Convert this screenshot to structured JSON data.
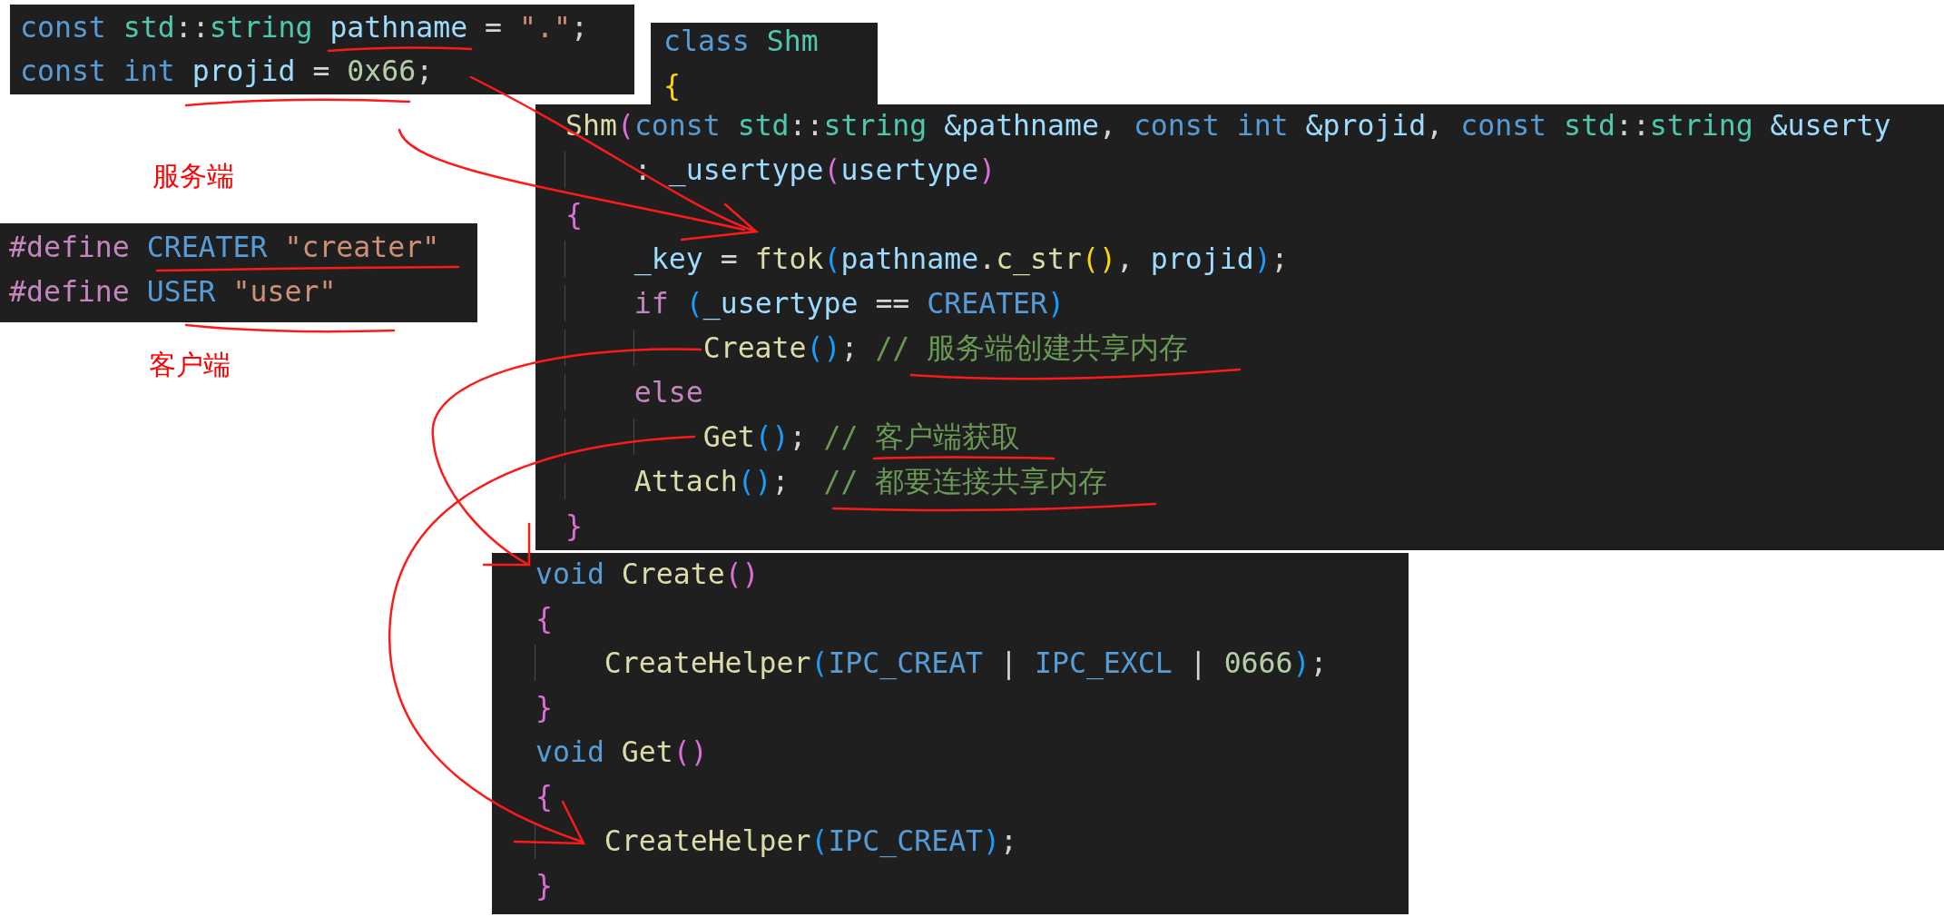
{
  "panels": [
    {
      "lines": [
        [
          {
            "text": "const",
            "color": "#569cd6"
          },
          {
            "text": " std",
            "color": "#4ec9b0"
          },
          {
            "text": "::",
            "color": "#d4d4d4"
          },
          {
            "text": "string",
            "color": "#4ec9b0"
          },
          {
            "text": " pathname",
            "color": "#9cdcfe"
          },
          {
            "text": " = ",
            "color": "#d4d4d4"
          },
          {
            "text": "\".\"",
            "color": "#ce9178"
          },
          {
            "text": ";",
            "color": "#d4d4d4"
          }
        ],
        [
          {
            "text": "const",
            "color": "#569cd6"
          },
          {
            "text": " int",
            "color": "#569cd6"
          },
          {
            "text": " projid",
            "color": "#9cdcfe"
          },
          {
            "text": " = ",
            "color": "#d4d4d4"
          },
          {
            "text": "0x66",
            "color": "#b5cea8"
          },
          {
            "text": ";",
            "color": "#d4d4d4"
          }
        ]
      ]
    },
    {
      "lines": [
        [
          {
            "text": "class",
            "color": "#569cd6"
          },
          {
            "text": " Shm",
            "color": "#4ec9b0"
          }
        ],
        [
          {
            "text": "{",
            "color": "#ffd700"
          }
        ]
      ]
    },
    {
      "lines": [
        [
          {
            "text": "Shm",
            "color": "#dcdcaa"
          },
          {
            "text": "(",
            "color": "#da70d6"
          },
          {
            "text": "const",
            "color": "#569cd6"
          },
          {
            "text": " std",
            "color": "#4ec9b0"
          },
          {
            "text": "::",
            "color": "#d4d4d4"
          },
          {
            "text": "string",
            "color": "#4ec9b0"
          },
          {
            "text": " &pathname",
            "color": "#9cdcfe"
          },
          {
            "text": ", ",
            "color": "#d4d4d4"
          },
          {
            "text": "const",
            "color": "#569cd6"
          },
          {
            "text": " int",
            "color": "#569cd6"
          },
          {
            "text": " &projid",
            "color": "#9cdcfe"
          },
          {
            "text": ", ",
            "color": "#d4d4d4"
          },
          {
            "text": "const",
            "color": "#569cd6"
          },
          {
            "text": " std",
            "color": "#4ec9b0"
          },
          {
            "text": "::",
            "color": "#d4d4d4"
          },
          {
            "text": "string",
            "color": "#4ec9b0"
          },
          {
            "text": " &userty",
            "color": "#9cdcfe"
          }
        ],
        [
          {
            "text": "    : ",
            "color": "#d4d4d4"
          },
          {
            "text": "_usertype",
            "color": "#9cdcfe"
          },
          {
            "text": "(",
            "color": "#da70d6"
          },
          {
            "text": "usertype",
            "color": "#9cdcfe"
          },
          {
            "text": ")",
            "color": "#da70d6"
          }
        ],
        [
          {
            "text": "{",
            "color": "#da70d6"
          }
        ],
        [
          {
            "text": "    _key",
            "color": "#9cdcfe"
          },
          {
            "text": " = ",
            "color": "#d4d4d4"
          },
          {
            "text": "ftok",
            "color": "#dcdcaa"
          },
          {
            "text": "(",
            "color": "#179fff"
          },
          {
            "text": "pathname",
            "color": "#9cdcfe"
          },
          {
            "text": ".",
            "color": "#d4d4d4"
          },
          {
            "text": "c_str",
            "color": "#dcdcaa"
          },
          {
            "text": "()",
            "color": "#ffd700"
          },
          {
            "text": ", ",
            "color": "#d4d4d4"
          },
          {
            "text": "projid",
            "color": "#9cdcfe"
          },
          {
            "text": ")",
            "color": "#179fff"
          },
          {
            "text": ";",
            "color": "#d4d4d4"
          }
        ],
        [
          {
            "text": "    if",
            "color": "#c586c0"
          },
          {
            "text": " (",
            "color": "#179fff"
          },
          {
            "text": "_usertype",
            "color": "#9cdcfe"
          },
          {
            "text": " == ",
            "color": "#d4d4d4"
          },
          {
            "text": "CREATER",
            "color": "#569cd6"
          },
          {
            "text": ")",
            "color": "#179fff"
          }
        ],
        [
          {
            "text": "        Create",
            "color": "#dcdcaa"
          },
          {
            "text": "()",
            "color": "#179fff"
          },
          {
            "text": "; ",
            "color": "#d4d4d4"
          },
          {
            "text": "// 服务端创建共享内存",
            "color": "#6a9955"
          }
        ],
        [
          {
            "text": "    else",
            "color": "#c586c0"
          }
        ],
        [
          {
            "text": "        Get",
            "color": "#dcdcaa"
          },
          {
            "text": "()",
            "color": "#179fff"
          },
          {
            "text": "; ",
            "color": "#d4d4d4"
          },
          {
            "text": "// 客户端获取",
            "color": "#6a9955"
          }
        ],
        [
          {
            "text": "    Attach",
            "color": "#dcdcaa"
          },
          {
            "text": "()",
            "color": "#179fff"
          },
          {
            "text": ";  ",
            "color": "#d4d4d4"
          },
          {
            "text": "// 都要连接共享内存",
            "color": "#6a9955"
          }
        ],
        [
          {
            "text": "}",
            "color": "#da70d6"
          }
        ]
      ]
    },
    {
      "lines": [
        [
          {
            "text": "#define",
            "color": "#c586c0"
          },
          {
            "text": " CREATER",
            "color": "#569cd6"
          },
          {
            "text": " \"creater\"",
            "color": "#ce9178"
          }
        ],
        [
          {
            "text": "#define",
            "color": "#c586c0"
          },
          {
            "text": " USER",
            "color": "#569cd6"
          },
          {
            "text": " \"user\"",
            "color": "#ce9178"
          }
        ]
      ]
    },
    {
      "lines": [
        [
          {
            "text": "void",
            "color": "#569cd6"
          },
          {
            "text": " Create",
            "color": "#dcdcaa"
          },
          {
            "text": "()",
            "color": "#da70d6"
          }
        ],
        [
          {
            "text": "{",
            "color": "#da70d6"
          }
        ],
        [
          {
            "text": "    CreateHelper",
            "color": "#dcdcaa"
          },
          {
            "text": "(",
            "color": "#179fff"
          },
          {
            "text": "IPC_CREAT",
            "color": "#569cd6"
          },
          {
            "text": " | ",
            "color": "#d4d4d4"
          },
          {
            "text": "IPC_EXCL",
            "color": "#569cd6"
          },
          {
            "text": " | ",
            "color": "#d4d4d4"
          },
          {
            "text": "0666",
            "color": "#b5cea8"
          },
          {
            "text": ")",
            "color": "#179fff"
          },
          {
            "text": ";",
            "color": "#d4d4d4"
          }
        ],
        [
          {
            "text": "}",
            "color": "#da70d6"
          }
        ],
        [
          {
            "text": "void",
            "color": "#569cd6"
          },
          {
            "text": " Get",
            "color": "#dcdcaa"
          },
          {
            "text": "()",
            "color": "#da70d6"
          }
        ],
        [
          {
            "text": "{",
            "color": "#da70d6"
          }
        ],
        [
          {
            "text": "    CreateHelper",
            "color": "#dcdcaa"
          },
          {
            "text": "(",
            "color": "#179fff"
          },
          {
            "text": "IPC_CREAT",
            "color": "#569cd6"
          },
          {
            "text": ")",
            "color": "#179fff"
          },
          {
            "text": ";",
            "color": "#d4d4d4"
          }
        ],
        [
          {
            "text": "}",
            "color": "#da70d6"
          }
        ]
      ]
    }
  ],
  "labels": [
    {
      "text": "服务端"
    },
    {
      "text": "客户端"
    }
  ]
}
